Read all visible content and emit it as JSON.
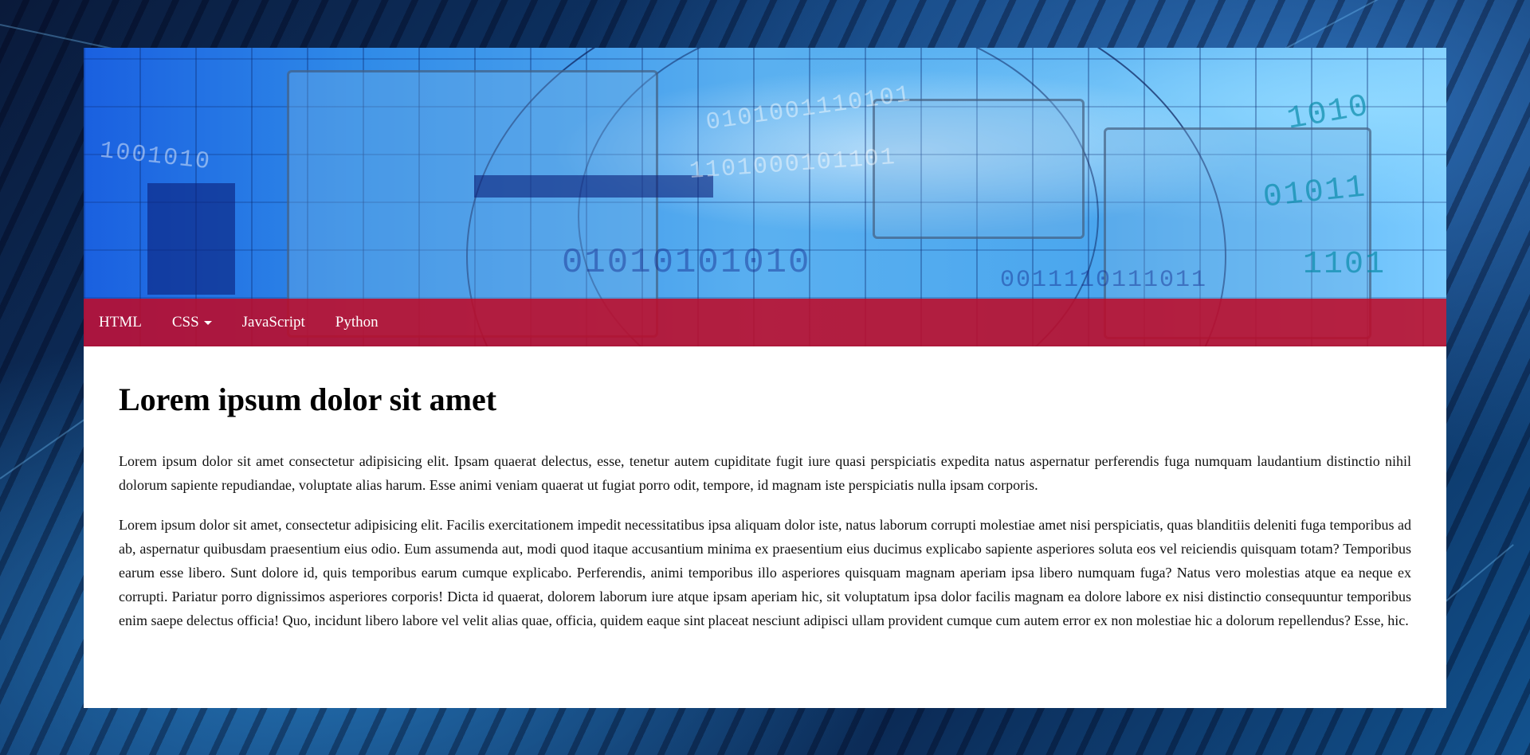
{
  "nav": {
    "items": [
      {
        "label": "HTML",
        "has_dropdown": false
      },
      {
        "label": "CSS",
        "has_dropdown": true
      },
      {
        "label": "JavaScript",
        "has_dropdown": false
      },
      {
        "label": "Python",
        "has_dropdown": false
      }
    ]
  },
  "content": {
    "heading": "Lorem ipsum dolor sit amet",
    "paragraphs": [
      "Lorem ipsum dolor sit amet consectetur adipisicing elit. Ipsam quaerat delectus, esse, tenetur autem cupiditate fugit iure quasi perspiciatis expedita natus aspernatur perferendis fuga numquam laudantium distinctio nihil dolorum sapiente repudiandae, voluptate alias harum. Esse animi veniam quaerat ut fugiat porro odit, tempore, id magnam iste perspiciatis nulla ipsam corporis.",
      "Lorem ipsum dolor sit amet, consectetur adipisicing elit. Facilis exercitationem impedit necessitatibus ipsa aliquam dolor iste, natus laborum corrupti molestiae amet nisi perspiciatis, quas blanditiis deleniti fuga temporibus ad ab, aspernatur quibusdam praesentium eius odio. Eum assumenda aut, modi quod itaque accusantium minima ex praesentium eius ducimus explicabo sapiente asperiores soluta eos vel reiciendis quisquam totam? Temporibus earum esse libero. Sunt dolore id, quis temporibus earum cumque explicabo. Perferendis, animi temporibus illo asperiores quisquam magnam aperiam ipsa libero numquam fuga? Natus vero molestias atque ea neque ex corrupti. Pariatur porro dignissimos asperiores corporis! Dicta id quaerat, dolorem laborum iure atque ipsam aperiam hic, sit voluptatum ipsa dolor facilis magnam ea dolore labore ex nisi distinctio consequuntur temporibus enim saepe delectus officia! Quo, incidunt libero labore vel velit alias quae, officia, quidem eaque sint placeat nesciunt adipisci ullam provident cumque cum autem error ex non molestiae hic a dolorum repellendus? Esse, hic."
    ]
  },
  "banner": {
    "binary_rows": [
      "0101001110101",
      "1101000101101",
      "01010101010",
      "0011110111011",
      "1001010"
    ],
    "teal_rows": [
      "1010",
      "01011",
      "1101"
    ]
  },
  "colors": {
    "navbar": "#be0a28",
    "page_background": "#0e3a70",
    "content_background": "#ffffff"
  }
}
